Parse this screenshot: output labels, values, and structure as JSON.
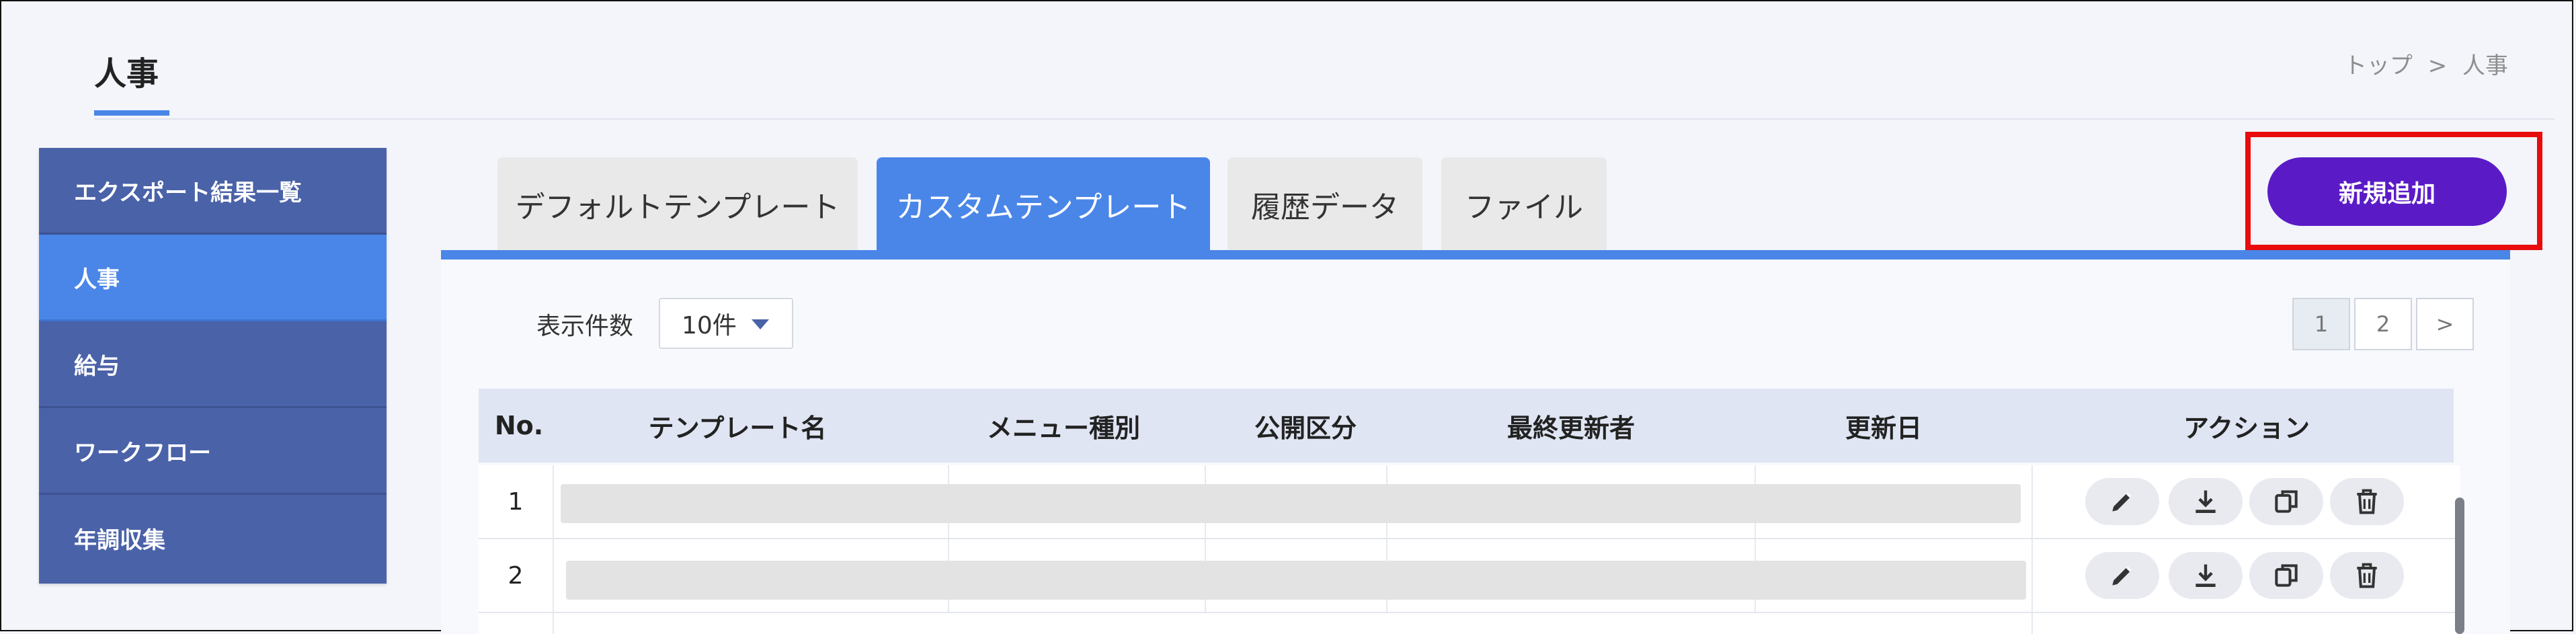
{
  "header": {
    "title": "人事",
    "breadcrumb": {
      "home": "トップ",
      "separator": ">",
      "current": "人事"
    }
  },
  "sidebar": {
    "items": [
      {
        "label": "エクスポート結果一覧",
        "active": false
      },
      {
        "label": "人事",
        "active": true
      },
      {
        "label": "給与",
        "active": false
      },
      {
        "label": "ワークフロー",
        "active": false
      },
      {
        "label": "年調収集",
        "active": false
      }
    ]
  },
  "tabs": [
    {
      "label": "デフォルトテンプレート",
      "active": false
    },
    {
      "label": "カスタムテンプレート",
      "active": true
    },
    {
      "label": "履歴データ",
      "active": false
    },
    {
      "label": "ファイル",
      "active": false
    }
  ],
  "add_button": {
    "label": "新規追加"
  },
  "display_count": {
    "label": "表示件数",
    "value": "10件"
  },
  "pagination": {
    "pages": [
      "1",
      "2"
    ],
    "current": "1",
    "next": ">"
  },
  "table": {
    "columns": [
      "No.",
      "テンプレート名",
      "メニュー種別",
      "公開区分",
      "最終更新者",
      "更新日",
      "アクション"
    ],
    "rows": [
      {
        "no": "1"
      },
      {
        "no": "2"
      }
    ]
  },
  "actions": [
    "pencil-icon",
    "download-icon",
    "copy-icon",
    "trash-icon"
  ],
  "colors": {
    "accent": "#4a86e8",
    "sidebar": "#4a62a8",
    "primary_button": "#5a1bc7",
    "highlight_outline": "#e80c0c"
  }
}
